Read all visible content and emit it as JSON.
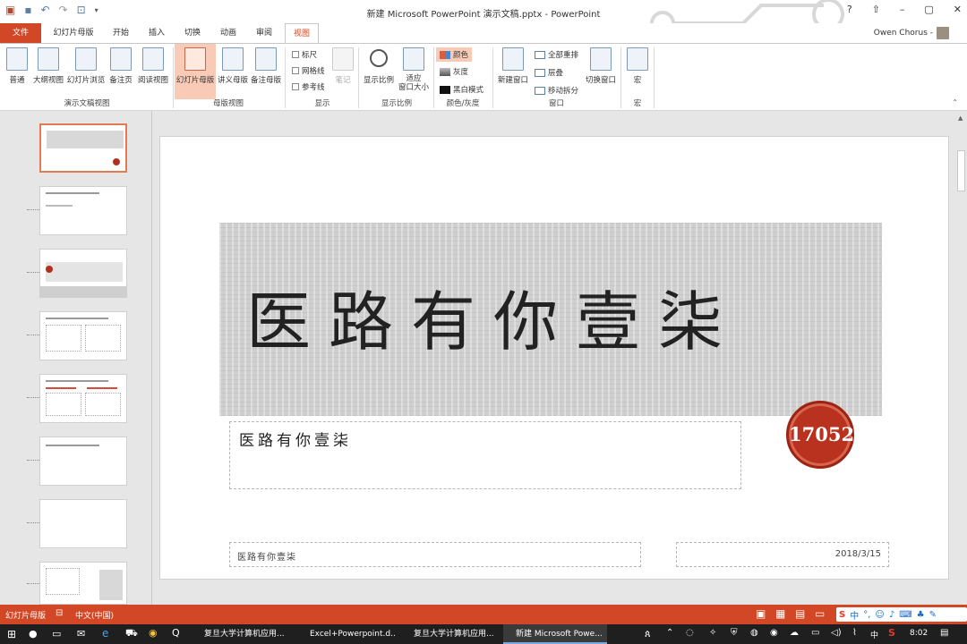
{
  "window": {
    "title": "新建 Microsoft PowerPoint 演示文稿.pptx - PowerPoint",
    "controls": [
      "?",
      "⇧",
      "–",
      "▢",
      "✕"
    ]
  },
  "user": {
    "name": "Owen Chorus -"
  },
  "tabs": [
    "文件",
    "幻灯片母版",
    "开始",
    "插入",
    "切换",
    "动画",
    "审阅",
    "视图"
  ],
  "ribbon": {
    "presentation_views": {
      "label": "演示文稿视图",
      "buttons": [
        "普通",
        "大纲视图",
        "幻灯片浏览",
        "备注页",
        "阅读视图"
      ]
    },
    "master_views": {
      "label": "母版视图",
      "buttons": [
        "幻灯片母版",
        "讲义母版",
        "备注母版"
      ]
    },
    "show": {
      "label": "显示",
      "checkboxes": [
        "标尺",
        "网格线",
        "参考线"
      ],
      "notes": "笔记"
    },
    "zoom": {
      "label": "显示比例",
      "buttons": [
        "显示比例",
        "适应\n窗口大小"
      ]
    },
    "color": {
      "label": "颜色/灰度",
      "options": [
        "颜色",
        "灰度",
        "黑白模式"
      ]
    },
    "window": {
      "label": "窗口",
      "new_window": "新建窗口",
      "options": [
        "全部重排",
        "层叠",
        "移动拆分"
      ],
      "switch": "切换窗口"
    },
    "macros": {
      "label": "宏",
      "button": "宏"
    }
  },
  "slide": {
    "title": "医路有你壹柒",
    "subtitle": "医路有你壹柒",
    "stamp": "17052",
    "footer_left": "医路有你壹柒",
    "footer_date": "2018/3/15"
  },
  "status": {
    "view": "幻灯片母版",
    "language": "中文(中国)"
  },
  "taskbar": {
    "items": [
      "复旦大学计算机应用...",
      "Excel+Powerpoint.d...",
      "复旦大学计算机应用...",
      "新建 Microsoft Powe..."
    ],
    "ime": "中",
    "time": "8:02"
  }
}
